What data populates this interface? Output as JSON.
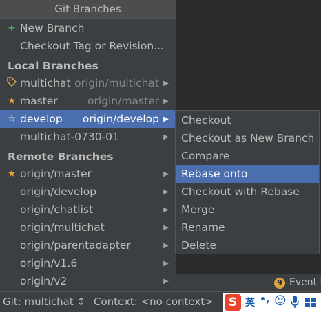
{
  "popup": {
    "title": "Git Branches",
    "new_branch": "New Branch",
    "checkout_tag": "Checkout Tag or Revision...",
    "local_header": "Local Branches",
    "local_branches": [
      {
        "name": "multichat",
        "remote": "origin/multichat",
        "icon": "tag-icon"
      },
      {
        "name": "master",
        "remote": "origin/master",
        "icon": "star-icon"
      },
      {
        "name": "develop",
        "remote": "origin/develop",
        "icon": "star-outline-icon"
      },
      {
        "name": "multichat-0730-01",
        "remote": "",
        "icon": "none"
      }
    ],
    "remote_header": "Remote Branches",
    "remote_branches": [
      {
        "name": "origin/master",
        "icon": "star-icon"
      },
      {
        "name": "origin/develop"
      },
      {
        "name": "origin/chatlist"
      },
      {
        "name": "origin/multichat"
      },
      {
        "name": "origin/parentadapter"
      },
      {
        "name": "origin/v1.6"
      },
      {
        "name": "origin/v2"
      }
    ]
  },
  "submenu": {
    "items": [
      "Checkout",
      "Checkout as New Branch",
      "Compare",
      "Rebase onto",
      "Checkout with Rebase",
      "Merge",
      "Rename",
      "Delete"
    ],
    "selected": "Rebase onto"
  },
  "event_log": {
    "badge": "9",
    "label": "Event L"
  },
  "status_bar": {
    "git": "Git: multichat ↕",
    "context": "Context: <no context>"
  },
  "ime": {
    "logo": "S",
    "lang": "英",
    "punc": "•,",
    "emoji": "☺"
  },
  "colors": {
    "background": "#3c3f41",
    "selection": "#4b6eaf",
    "star": "#e8a33a",
    "plus": "#59a869",
    "ime_logo": "#e8452c"
  }
}
